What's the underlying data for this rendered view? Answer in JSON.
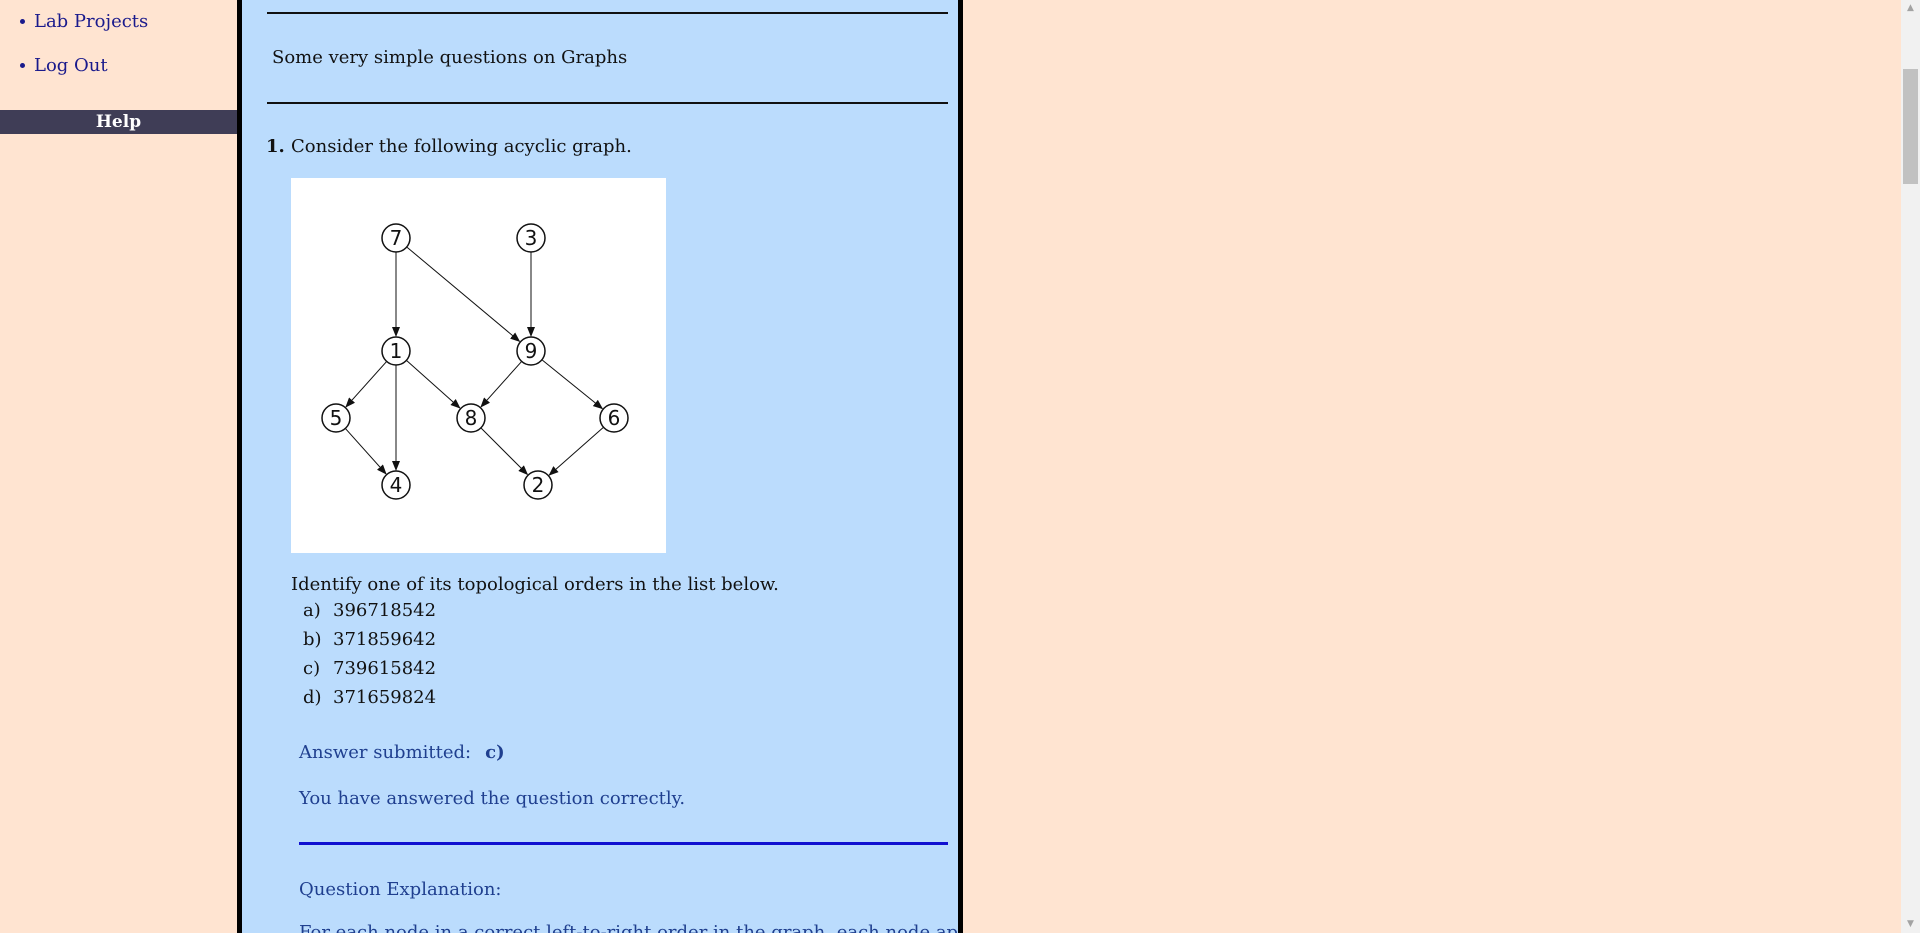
{
  "sidebar": {
    "items": [
      {
        "label": "Lab Projects"
      },
      {
        "label": "Log Out"
      }
    ],
    "help_label": "Help"
  },
  "content": {
    "heading": "Some very simple questions on Graphs",
    "question": {
      "number": "1.",
      "text": "Consider the following acyclic graph.",
      "prompt": "Identify one of its topological orders in the list below.",
      "options": [
        {
          "letter": "a)",
          "value": "396718542"
        },
        {
          "letter": "b)",
          "value": "371859642"
        },
        {
          "letter": "c)",
          "value": "739615842"
        },
        {
          "letter": "d)",
          "value": "371659824"
        }
      ],
      "answer_label": "Answer submitted:",
      "answer_value": "c)",
      "feedback": "You have answered the question correctly.",
      "explanation_title": "Question Explanation:",
      "explanation_text": "For each node in a correct left-to-right order in the graph, each node appears that"
    },
    "graph": {
      "nodes": [
        {
          "id": "7",
          "label": "7"
        },
        {
          "id": "3",
          "label": "3"
        },
        {
          "id": "1",
          "label": "1"
        },
        {
          "id": "9",
          "label": "9"
        },
        {
          "id": "5",
          "label": "5"
        },
        {
          "id": "8",
          "label": "8"
        },
        {
          "id": "6",
          "label": "6"
        },
        {
          "id": "4",
          "label": "4"
        },
        {
          "id": "2",
          "label": "2"
        }
      ],
      "edges": [
        {
          "from": "7",
          "to": "1"
        },
        {
          "from": "7",
          "to": "9"
        },
        {
          "from": "3",
          "to": "9"
        },
        {
          "from": "1",
          "to": "5"
        },
        {
          "from": "1",
          "to": "4"
        },
        {
          "from": "1",
          "to": "8"
        },
        {
          "from": "9",
          "to": "8"
        },
        {
          "from": "9",
          "to": "6"
        },
        {
          "from": "5",
          "to": "4"
        },
        {
          "from": "8",
          "to": "2"
        },
        {
          "from": "6",
          "to": "2"
        }
      ]
    }
  },
  "colors": {
    "page_background": "#ffe4d1",
    "content_background": "#bbdcfd",
    "help_bar": "#3f3d56",
    "link": "#1a1a8c",
    "feedback_text": "#1f3f8f",
    "divider_blue": "#1010d0"
  }
}
